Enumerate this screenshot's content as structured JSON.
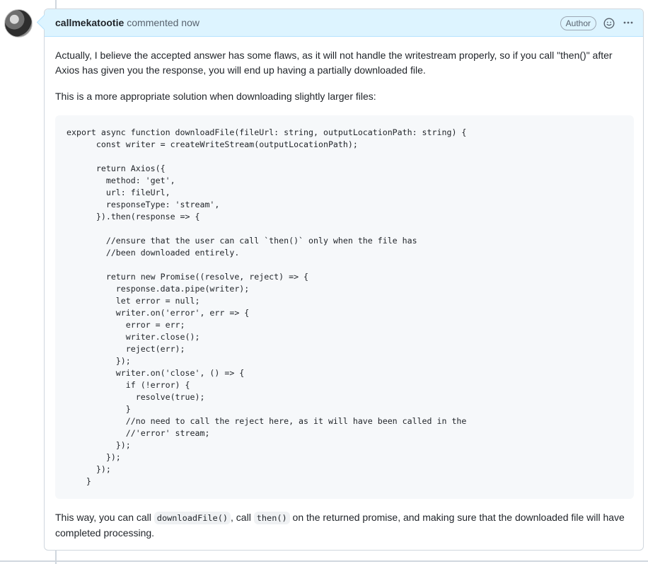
{
  "comment": {
    "author": "callmekatootie",
    "timestamp": "commented now",
    "badge": "Author",
    "icons": {
      "reaction": "smiley-icon",
      "menu": "kebab-horizontal-icon"
    }
  },
  "body": {
    "para1": "Actually, I believe the accepted answer has some flaws, as it will not handle the writestream properly, so if you call \"then()\" after Axios has given you the response, you will end up having a partially downloaded file.",
    "para2": "This is a more appropriate solution when downloading slightly larger files:",
    "code": "export async function downloadFile(fileUrl: string, outputLocationPath: string) {\n      const writer = createWriteStream(outputLocationPath);\n\n      return Axios({\n        method: 'get',\n        url: fileUrl,\n        responseType: 'stream',\n      }).then(response => {\n\n        //ensure that the user can call `then()` only when the file has\n        //been downloaded entirely.\n\n        return new Promise((resolve, reject) => {\n          response.data.pipe(writer);\n          let error = null;\n          writer.on('error', err => {\n            error = err;\n            writer.close();\n            reject(err);\n          });\n          writer.on('close', () => {\n            if (!error) {\n              resolve(true);\n            }\n            //no need to call the reject here, as it will have been called in the\n            //'error' stream;\n          });\n        });\n      });\n    }",
    "para3_prefix": "This way, you can call ",
    "para3_code1": "downloadFile()",
    "para3_mid": ", call ",
    "para3_code2": "then()",
    "para3_suffix": " on the returned promise, and making sure that the downloaded file will have completed processing."
  }
}
